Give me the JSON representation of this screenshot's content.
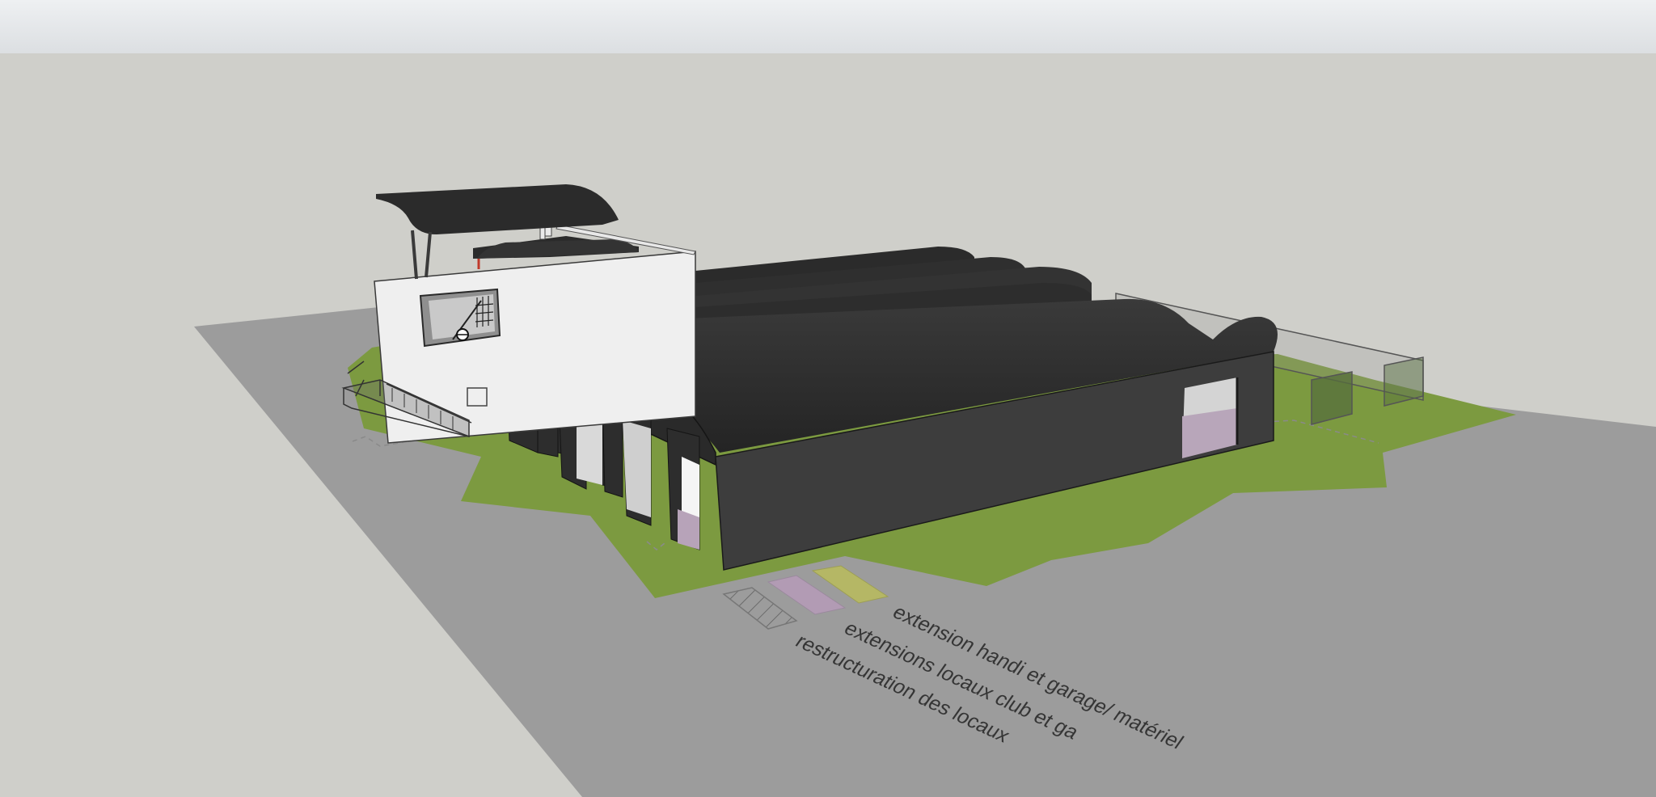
{
  "scene": {
    "legend": {
      "items": [
        {
          "label": "extension handi et garage/ matériel",
          "swatch": "yellow"
        },
        {
          "label": "extensions locaux club et ga",
          "swatch": "purple"
        },
        {
          "label": "restructuration des locaux",
          "swatch": "hatched"
        }
      ]
    }
  },
  "colors": {
    "sky": "#cfcfca",
    "ground": "#9c9c9c",
    "grass": "#7c9a40",
    "roof": "#2f2f2f",
    "wall_white": "#efefef",
    "swatch_yellow": "#b5b765",
    "swatch_purple": "#b29bb4"
  }
}
